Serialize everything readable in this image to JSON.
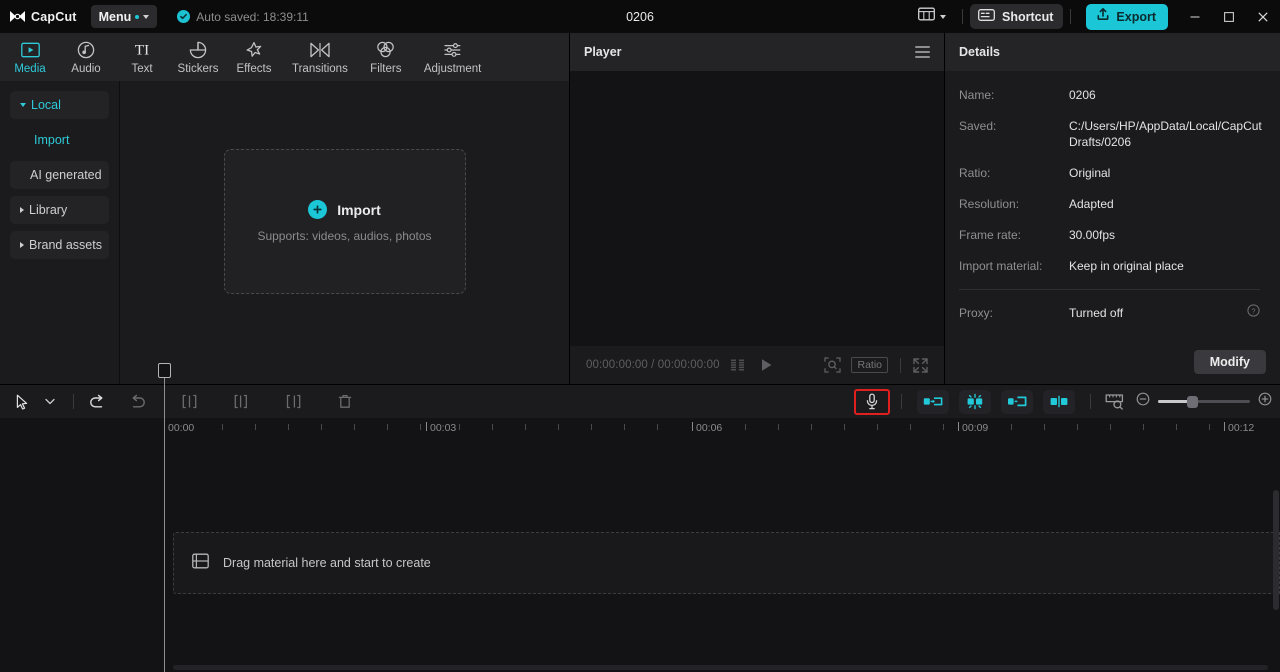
{
  "titlebar": {
    "brand": "CapCut",
    "menu_label": "Menu",
    "autosave": "Auto saved: 18:39:11",
    "document_title": "0206",
    "layout_icon": "layout-icon",
    "shortcut_label": "Shortcut",
    "export_label": "Export",
    "minimize": "minimize-icon",
    "maximize": "maximize-icon",
    "close": "close-icon"
  },
  "tabs": [
    {
      "label": "Media",
      "icon": "media-icon",
      "active": true
    },
    {
      "label": "Audio",
      "icon": "audio-icon",
      "active": false
    },
    {
      "label": "Text",
      "icon": "text-icon",
      "active": false
    },
    {
      "label": "Stickers",
      "icon": "stickers-icon",
      "active": false
    },
    {
      "label": "Effects",
      "icon": "effects-icon",
      "active": false
    },
    {
      "label": "Transitions",
      "icon": "transitions-icon",
      "active": false
    },
    {
      "label": "Filters",
      "icon": "filters-icon",
      "active": false
    },
    {
      "label": "Adjustment",
      "icon": "adjustment-icon",
      "active": false
    }
  ],
  "sidebar": {
    "items": [
      {
        "label": "Local",
        "expanded": true
      },
      {
        "label": "Import",
        "sub": true
      },
      {
        "label": "AI generated"
      },
      {
        "label": "Library",
        "expanded": false
      },
      {
        "label": "Brand assets",
        "expanded": false
      }
    ]
  },
  "dropzone": {
    "title": "Import",
    "subtitle": "Supports: videos, audios, photos"
  },
  "player": {
    "title": "Player",
    "current_time": "00:00:00:00",
    "total_time": "00:00:00:00",
    "timecode": "00:00:00:00 / 00:00:00:00",
    "ratio_label": "Ratio"
  },
  "details": {
    "title": "Details",
    "rows": [
      {
        "key": "Name:",
        "value": "0206"
      },
      {
        "key": "Saved:",
        "value": "C:/Users/HP/AppData/Local/CapCut Drafts/0206"
      },
      {
        "key": "Ratio:",
        "value": "Original"
      },
      {
        "key": "Resolution:",
        "value": "Adapted"
      },
      {
        "key": "Frame rate:",
        "value": "30.00fps"
      },
      {
        "key": "Import material:",
        "value": "Keep in original place"
      }
    ],
    "proxy": {
      "key": "Proxy:",
      "value": "Turned off"
    },
    "modify_label": "Modify"
  },
  "timeline": {
    "ruler_labels": [
      "00:00",
      "00:03",
      "00:06",
      "00:09",
      "00:12"
    ],
    "drop_text": "Drag material here and start to create",
    "zoom_percent": 33
  },
  "colors": {
    "accent": "#1bc6d6",
    "accent_text": "#2ecad8",
    "highlight_box": "#e02020",
    "panel_bg": "#1b1b1d",
    "timeline_bg": "#131315"
  }
}
